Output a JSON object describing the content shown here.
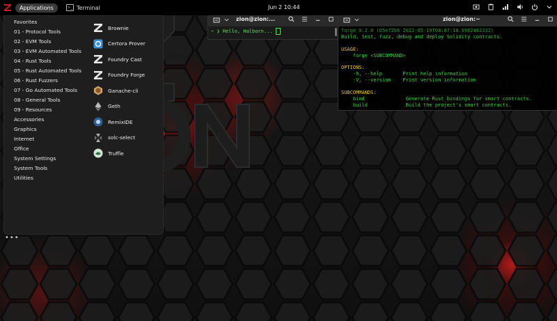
{
  "topbar": {
    "applications_label": "Applications",
    "terminal_label": "Terminal",
    "clock": "Jun 2  10:44"
  },
  "menu": {
    "categories": [
      "Favorites",
      "01 - Protocol Tools",
      "02 - EVM Tools",
      "03 - EVM Automated Tools",
      "04 - Rust Tools",
      "05 - Rust Automated Tools",
      "06 - Rust Fuzzers",
      "07 - Go Automated Tools",
      "08 - General Tools",
      "09 - Resources",
      "Accessories",
      "Graphics",
      "Internet",
      "Office",
      "System Settings",
      "System Tools",
      "Utilities"
    ],
    "apps": [
      {
        "label": "Brownie",
        "icon": "brownie-icon"
      },
      {
        "label": "Certora Prover",
        "icon": "certora-icon"
      },
      {
        "label": "Foundry Cast",
        "icon": "foundry-cast-icon"
      },
      {
        "label": "Foundry Forge",
        "icon": "foundry-forge-icon"
      },
      {
        "label": "Ganache-cli",
        "icon": "ganache-icon"
      },
      {
        "label": "Geth",
        "icon": "geth-icon"
      },
      {
        "label": "RemixIDE",
        "icon": "remix-icon"
      },
      {
        "label": "solc-select",
        "icon": "solc-icon"
      },
      {
        "label": "Truffle",
        "icon": "truffle-icon"
      }
    ],
    "more_dots": "•••"
  },
  "terminal1": {
    "title": "zion@zion:...",
    "prompt": "~ ❯ Hello, Halborn...",
    "colors": {
      "text": "#59e359"
    }
  },
  "terminal2": {
    "title": "zion@zion:~",
    "lines": [
      {
        "text": "forge 0.2.0 (05e72b6 2022-05-19T08:07:10.996248233Z)",
        "cls": "dim"
      },
      {
        "text": "Build, test, fuzz, debug and deploy Solidity contracts.",
        "cls": ""
      },
      {
        "text": " ",
        "cls": ""
      },
      {
        "text": "USAGE:",
        "cls": "hl"
      },
      {
        "text": "    forge <SUBCOMMAND>",
        "cls": ""
      },
      {
        "text": " ",
        "cls": ""
      },
      {
        "text": "OPTIONS:",
        "cls": "hl"
      },
      {
        "text": "    -h, --help       Print help information",
        "cls": ""
      },
      {
        "text": "    -V, --version    Print version information",
        "cls": ""
      },
      {
        "text": " ",
        "cls": ""
      },
      {
        "text": "SUBCOMMANDS:",
        "cls": "hl"
      },
      {
        "text": "    bind              Generate Rust bindings for smart contracts.",
        "cls": ""
      },
      {
        "text": "    build             Build the project's smart contracts.",
        "cls": ""
      }
    ]
  },
  "wallpaper": {
    "logo_text": "ZION",
    "accent": "#c0161b"
  }
}
